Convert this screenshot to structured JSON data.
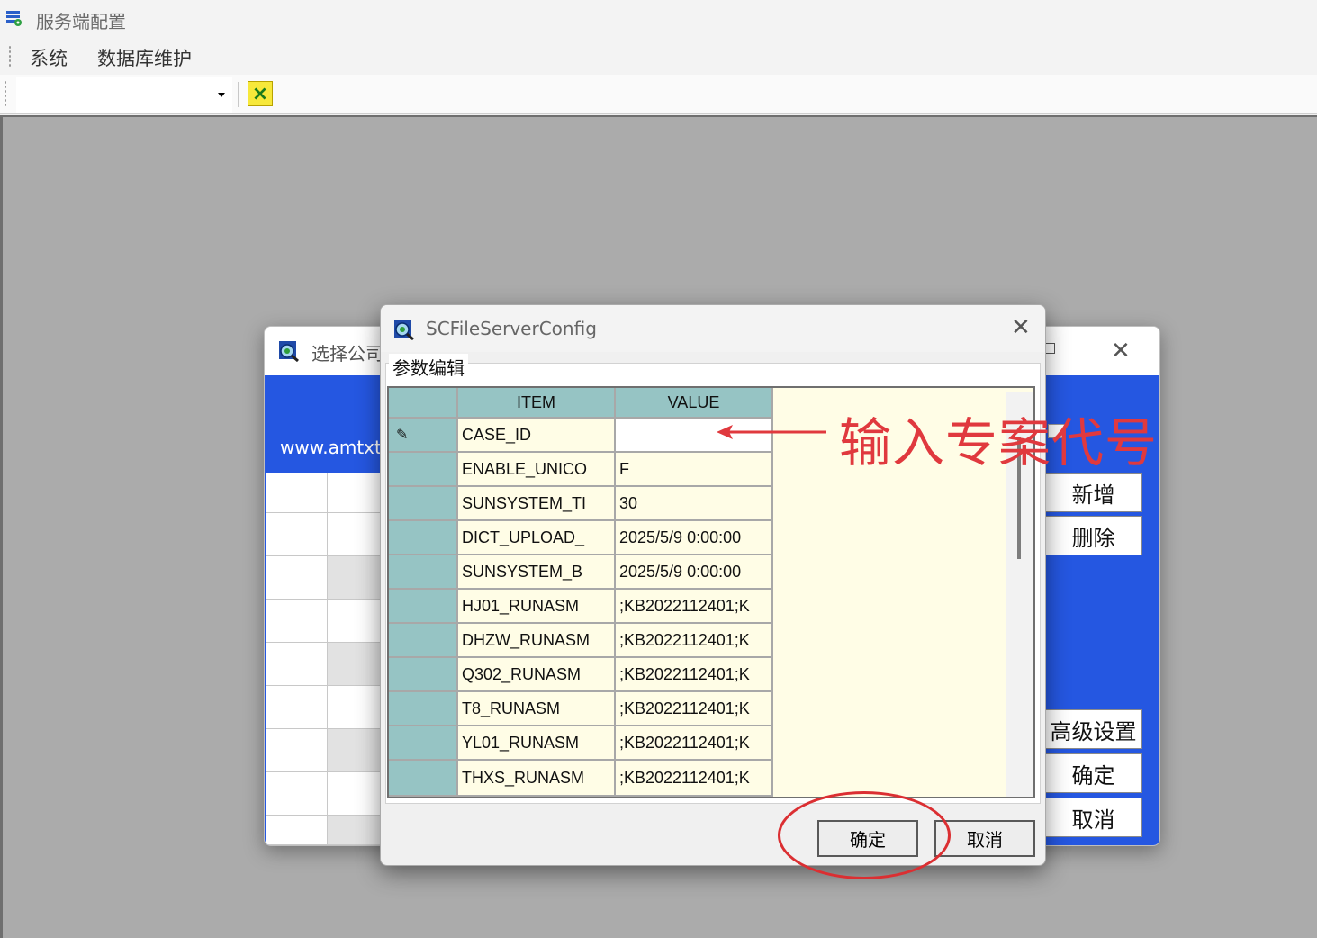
{
  "window": {
    "title": "服务端配置"
  },
  "menu": {
    "items": [
      "系统",
      "数据库维护"
    ]
  },
  "toolbar": {
    "combo_value": ""
  },
  "back_dialog": {
    "title": "选择公司",
    "url": "www.amtxt",
    "buttons": {
      "add": "新增",
      "delete": "删除",
      "advanced": "高级设置",
      "ok": "确定",
      "cancel": "取消"
    }
  },
  "dialog": {
    "title": "SCFileServerConfig",
    "group_label": "参数编辑",
    "columns": [
      "ITEM",
      "VALUE"
    ],
    "rows": [
      {
        "item": "CASE_ID",
        "value": ""
      },
      {
        "item": "ENABLE_UNICO",
        "value": "F"
      },
      {
        "item": "SUNSYSTEM_TI",
        "value": "30"
      },
      {
        "item": "DICT_UPLOAD_",
        "value": "2025/5/9 0:00:00"
      },
      {
        "item": "SUNSYSTEM_B",
        "value": "2025/5/9 0:00:00"
      },
      {
        "item": "HJ01_RUNASM",
        "value": ";KB2022112401;K"
      },
      {
        "item": "DHZW_RUNASM",
        "value": ";KB2022112401;K"
      },
      {
        "item": "Q302_RUNASM",
        "value": ";KB2022112401;K"
      },
      {
        "item": "T8_RUNASM",
        "value": ";KB2022112401;K"
      },
      {
        "item": "YL01_RUNASM",
        "value": ";KB2022112401;K"
      },
      {
        "item": "THXS_RUNASM",
        "value": ";KB2022112401;K"
      }
    ],
    "ok_label": "确定",
    "cancel_label": "取消"
  },
  "annotation": {
    "text": "输入专案代号",
    "color": "#e0393e"
  },
  "icons": {
    "app": "grid-settings-icon",
    "dialog": "globe-app-icon",
    "exit": "exit-icon",
    "row_editing": "pencil-icon"
  },
  "colors": {
    "header_teal": "#96c4c4",
    "grid_bg": "#fffde6",
    "back_blue": "#2557e1",
    "workspace": "#ababab"
  }
}
